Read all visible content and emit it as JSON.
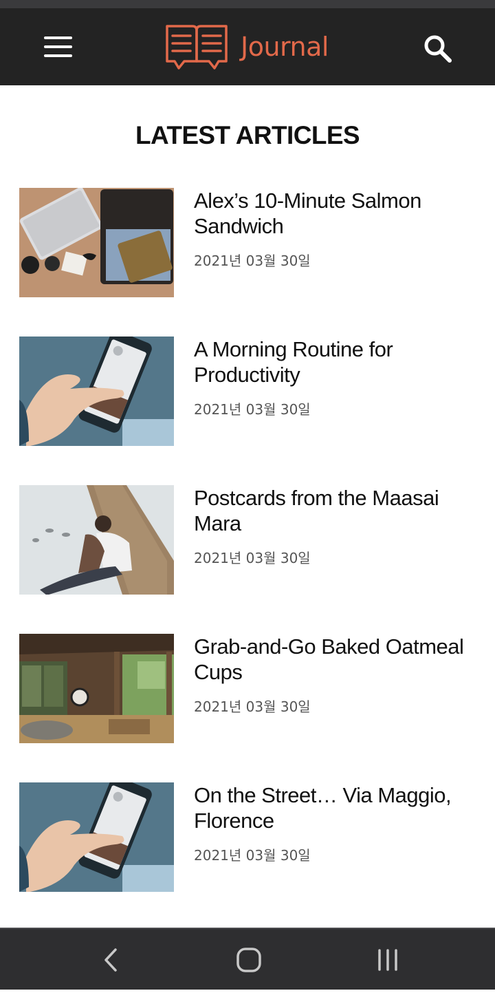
{
  "header": {
    "app_name": "Journal",
    "accent_color": "#e2694a",
    "menu_icon": "hamburger-menu-icon",
    "search_icon": "search-icon"
  },
  "section": {
    "title": "LATEST ARTICLES"
  },
  "articles": [
    {
      "title": "Alex’s 10-Minute Salmon Sandwich",
      "date": "2021년 03월 30일",
      "thumbnail": "laptop-and-suitcase-photo"
    },
    {
      "title": "A Morning Routine for Productivity",
      "date": "2021년 03월 30일",
      "thumbnail": "hand-holding-phone-photo"
    },
    {
      "title": "Postcards from the Maasai Mara",
      "date": "2021년 03월 30일",
      "thumbnail": "couple-on-pier-photo"
    },
    {
      "title": "Grab-and-Go Baked Oatmeal Cups",
      "date": "2021년 03월 30일",
      "thumbnail": "porch-living-room-photo"
    },
    {
      "title": "On the Street… Via Maggio, Florence",
      "date": "2021년 03월 30일",
      "thumbnail": "hand-holding-phone-photo"
    }
  ],
  "system_nav": {
    "back_icon": "back-icon",
    "home_icon": "home-icon",
    "recents_icon": "recent-apps-icon"
  }
}
